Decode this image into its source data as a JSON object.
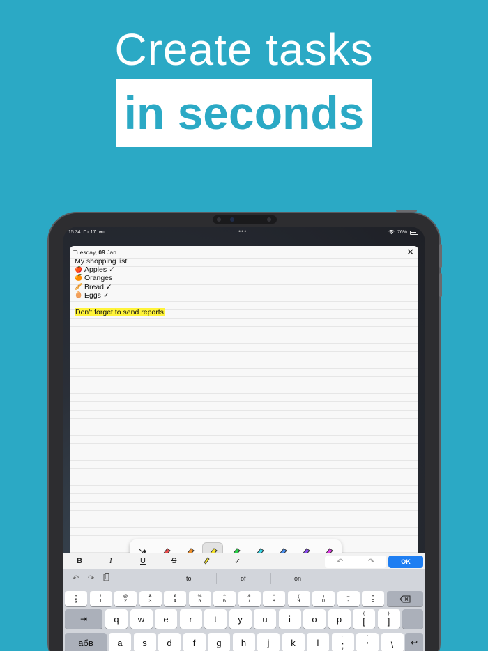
{
  "headline": {
    "line1": "Create tasks",
    "line2": "in seconds"
  },
  "status_bar": {
    "time": "15:34",
    "date": "Пт 17 лют.",
    "battery": "76%"
  },
  "note": {
    "date_prefix": "Tuesday, ",
    "date_day": "09",
    "date_month": " Jan",
    "title": "My shopping list",
    "items": [
      {
        "emoji": "🍎",
        "text": "Apples ✓"
      },
      {
        "emoji": "🍊",
        "text": "Oranges"
      },
      {
        "emoji": "🥖",
        "text": "Bread ✓"
      },
      {
        "emoji": "🥚",
        "text": "Eggs ✓"
      }
    ],
    "highlight_text": "Don't forget to send reports",
    "highlight_color": "#fff43a"
  },
  "pens": [
    {
      "name": "eraser",
      "color": "#222222"
    },
    {
      "name": "red",
      "color": "#e84c4c"
    },
    {
      "name": "orange",
      "color": "#f0902a"
    },
    {
      "name": "yellow",
      "color": "#f7e52b",
      "selected": true
    },
    {
      "name": "green",
      "color": "#2bd34a"
    },
    {
      "name": "cyan",
      "color": "#38d7e8"
    },
    {
      "name": "blue",
      "color": "#4a8ff0"
    },
    {
      "name": "purple",
      "color": "#8a4cf0"
    },
    {
      "name": "magenta",
      "color": "#e23ce8"
    }
  ],
  "format_bar": {
    "bold": "B",
    "italic": "I",
    "underline": "U",
    "strike": "S",
    "check": "✓",
    "ok": "OK"
  },
  "suggestions": [
    "to",
    "of",
    "on"
  ],
  "number_row": [
    {
      "top": "±",
      "bot": "§"
    },
    {
      "top": "!",
      "bot": "1"
    },
    {
      "top": "@",
      "bot": "2"
    },
    {
      "top": "₴",
      "bot": "3"
    },
    {
      "top": "€",
      "bot": "4"
    },
    {
      "top": "%",
      "bot": "5"
    },
    {
      "top": "^",
      "bot": "6"
    },
    {
      "top": "&",
      "bot": "7"
    },
    {
      "top": "*",
      "bot": "8"
    },
    {
      "top": "(",
      "bot": "9"
    },
    {
      "top": ")",
      "bot": "0"
    },
    {
      "top": "–",
      "bot": "-"
    },
    {
      "top": "+",
      "bot": "="
    }
  ],
  "letter_row1": [
    "q",
    "w",
    "e",
    "r",
    "t",
    "y",
    "u",
    "i",
    "o",
    "p"
  ],
  "letter_row1_extra": [
    {
      "top": "{",
      "bot": "["
    },
    {
      "top": "}",
      "bot": "]"
    }
  ],
  "letter_row2": [
    "a",
    "s",
    "d",
    "f",
    "g",
    "h",
    "j",
    "k",
    "l"
  ],
  "letter_row2_extra": [
    {
      "top": ":",
      "bot": ";"
    },
    {
      "top": "\"",
      "bot": "'"
    },
    {
      "top": "|",
      "bot": "\\"
    }
  ],
  "lang_key": "абв"
}
